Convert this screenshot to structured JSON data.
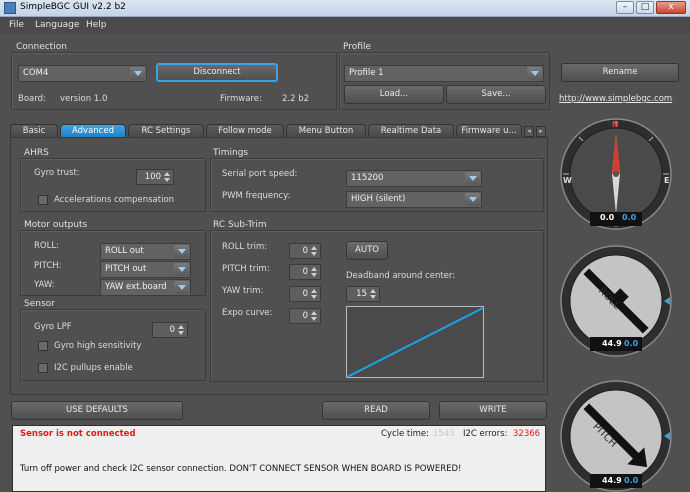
{
  "window": {
    "title": "SimpleBGC GUI v2.2 b2",
    "min": "–",
    "max": "□",
    "close": "x"
  },
  "menu": [
    "File",
    "Language",
    "Help"
  ],
  "connection": {
    "title": "Connection",
    "port": "COM4",
    "connect_button": "Disconnect",
    "board_label": "Board:",
    "board_value": "version 1.0",
    "firmware_label": "Firmware:",
    "firmware_value": "2.2 b2"
  },
  "profile": {
    "title": "Profile",
    "selected": "Profile 1",
    "rename_button": "Rename",
    "load_button": "Load...",
    "save_button": "Save...",
    "link": "http://www.simplebgc.com"
  },
  "tabs": [
    "Basic",
    "Advanced",
    "RC Settings",
    "Follow mode",
    "Menu Button",
    "Realtime Data",
    "Firmware u..."
  ],
  "tab_nav": {
    "prev": "◂",
    "next": "▸"
  },
  "ahrs": {
    "title": "AHRS",
    "gyro_trust_label": "Gyro trust:",
    "gyro_trust_value": "100",
    "acc_comp_label": "Accelerations compensation"
  },
  "timings": {
    "title": "Timings",
    "serial_label": "Serial port speed:",
    "serial_value": "115200",
    "pwm_label": "PWM frequency:",
    "pwm_value": "HIGH (silent)"
  },
  "motor_outputs": {
    "title": "Motor outputs",
    "roll_label": "ROLL:",
    "roll_value": "ROLL out",
    "pitch_label": "PITCH:",
    "pitch_value": "PITCH out",
    "yaw_label": "YAW:",
    "yaw_value": "YAW ext.board"
  },
  "rc_subtrim": {
    "title": "RC Sub-Trim",
    "roll_label": "ROLL trim:",
    "roll_value": "0",
    "pitch_label": "PITCH trim:",
    "pitch_value": "0",
    "yaw_label": "YAW trim:",
    "yaw_value": "0",
    "expo_label": "Expo curve:",
    "expo_value": "0",
    "auto_button": "AUTO",
    "deadband_label": "Deadband around center:",
    "deadband_value": "15"
  },
  "sensor": {
    "title": "Sensor",
    "gyro_lpf_label": "Gyro LPF",
    "gyro_lpf_value": "0",
    "high_sens_label": "Gyro high sensitivity",
    "i2c_label": "I2C pullups enable"
  },
  "buttons": {
    "defaults": "USE DEFAULTS",
    "read": "READ",
    "write": "WRITE"
  },
  "status": {
    "error": "Sensor is not connected",
    "cycle_label": "Cycle time:",
    "cycle_value": "1543",
    "i2c_label": "I2C errors:",
    "i2c_value": "32366",
    "message": "Turn off power and check I2C sensor connection. DON'T CONNECT SENSOR WHEN BOARD IS POWERED!"
  },
  "gauges": {
    "yaw": {
      "n": "N",
      "w": "W",
      "e": "E",
      "value_white": "0.0",
      "value_blue": "0.0"
    },
    "roll": {
      "label": "ROLL",
      "value_white": "44.9",
      "value_blue": "0.0"
    },
    "pitch": {
      "label": "PITCH",
      "value_white": "44.9",
      "value_blue": "0.0"
    }
  },
  "colors": {
    "accent": "#2f95dc",
    "error": "#e01b1b",
    "panel": "#505050",
    "curve": "#1ea0e6"
  }
}
